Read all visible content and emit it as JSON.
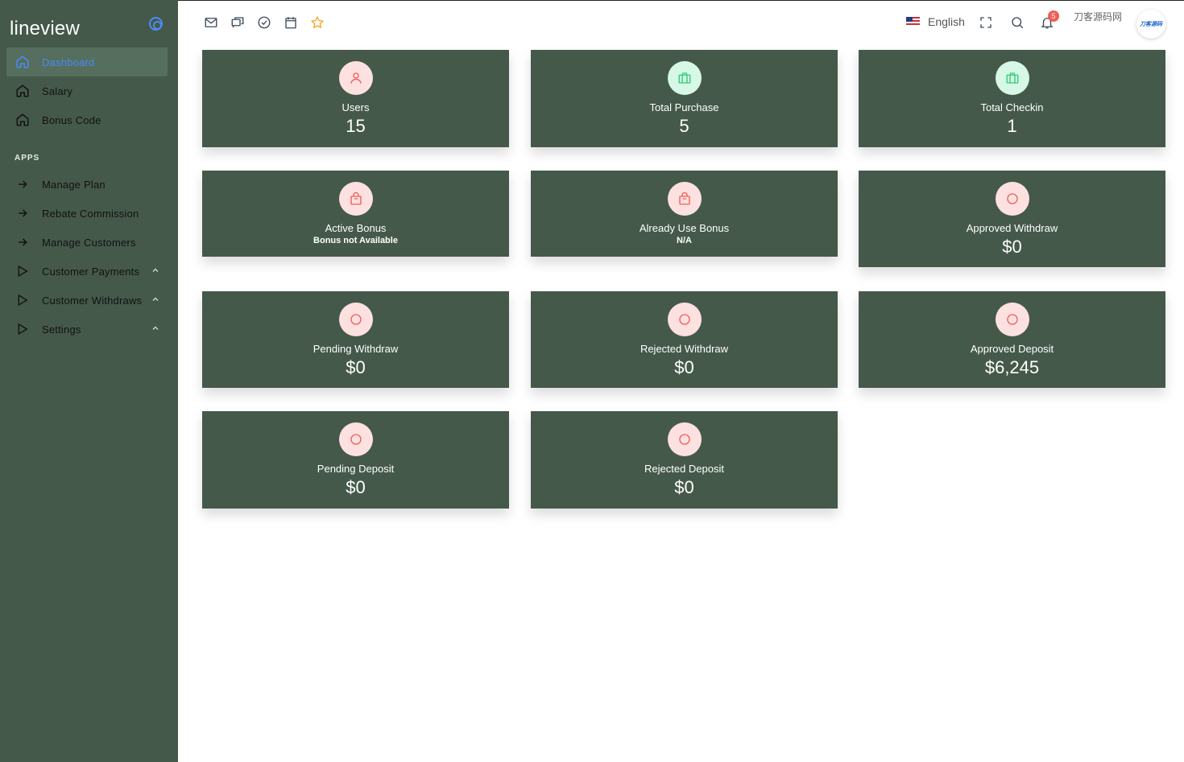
{
  "sidebar": {
    "brand": "lineview",
    "items": [
      {
        "label": "Dashboard",
        "icon": "home-icon"
      },
      {
        "label": "Salary",
        "icon": "home-icon"
      },
      {
        "label": "Bonus Code",
        "icon": "home-icon"
      }
    ],
    "section_title": "APPS",
    "apps": [
      {
        "label": "Manage Plan",
        "icon": "arrow-right-icon"
      },
      {
        "label": "Rebate Commission",
        "icon": "arrow-right-icon"
      },
      {
        "label": "Manage Customers",
        "icon": "arrow-right-icon"
      },
      {
        "label": "Customer Payments",
        "icon": "play-icon"
      },
      {
        "label": "Customer Withdraws",
        "icon": "play-icon"
      },
      {
        "label": "Settings",
        "icon": "play-icon"
      }
    ],
    "active_color": "#4a8bf5",
    "bg_color": "#45594a"
  },
  "topbar": {
    "icons": [
      "mail-icon",
      "chat-icon",
      "check-circle-icon",
      "calendar-icon",
      "star-icon"
    ],
    "language": "English",
    "notification_count": "5",
    "watermark": "刀客源码网",
    "avatar_text": "刀客源码"
  },
  "cards": [
    {
      "label": "Users",
      "value": "15",
      "icon": "user-icon",
      "icon_tone": "pink"
    },
    {
      "label": "Total Purchase",
      "value": "5",
      "icon": "briefcase-icon",
      "icon_tone": "green"
    },
    {
      "label": "Total Checkin",
      "value": "1",
      "icon": "briefcase-icon",
      "icon_tone": "green"
    },
    {
      "label": "Active Bonus",
      "sub": "Bonus not Available",
      "icon": "shopping-bag-icon",
      "icon_tone": "pink"
    },
    {
      "label": "Already Use Bonus",
      "sub": "N/A",
      "icon": "shopping-bag-icon",
      "icon_tone": "pink"
    },
    {
      "label": "Approved Withdraw",
      "value": "$0",
      "icon": "circle-icon",
      "icon_tone": "pink"
    },
    {
      "label": "Pending Withdraw",
      "value": "$0",
      "icon": "circle-icon",
      "icon_tone": "pink"
    },
    {
      "label": "Rejected Withdraw",
      "value": "$0",
      "icon": "circle-icon",
      "icon_tone": "pink"
    },
    {
      "label": "Approved Deposit",
      "value": "$6,245",
      "icon": "circle-icon",
      "icon_tone": "pink"
    },
    {
      "label": "Pending Deposit",
      "value": "$0",
      "icon": "circle-icon",
      "icon_tone": "pink"
    },
    {
      "label": "Rejected Deposit",
      "value": "$0",
      "icon": "circle-icon",
      "icon_tone": "pink"
    }
  ]
}
